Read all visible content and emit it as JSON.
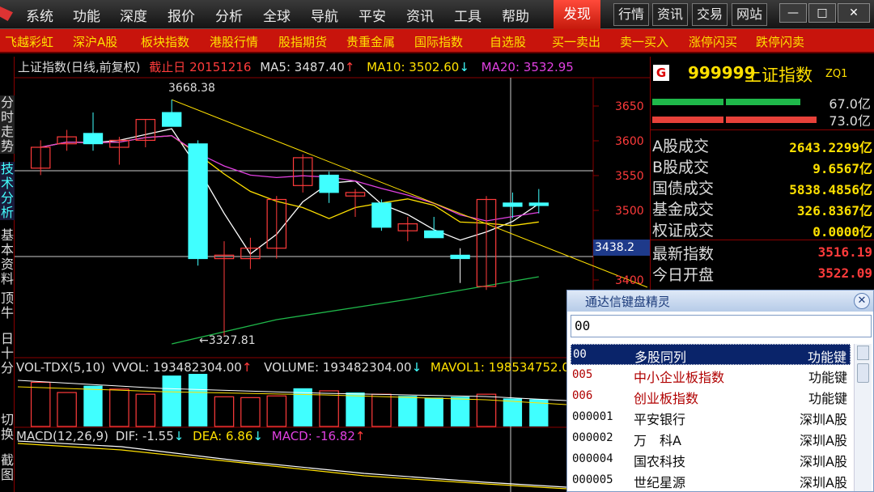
{
  "menubar": {
    "items": [
      "系统",
      "功能",
      "深度",
      "报价",
      "分析",
      "全球",
      "导航",
      "平安",
      "资讯",
      "工具",
      "帮助"
    ],
    "selected": "发现",
    "tabs": [
      "行情",
      "资讯",
      "交易",
      "网站"
    ],
    "window_controls": [
      "—",
      "□",
      "✕"
    ]
  },
  "quickbar": {
    "items": [
      "飞越彩虹",
      "深沪A股",
      "板块指数",
      "港股行情",
      "股指期货",
      "贵重金属",
      "国际指数",
      "自选股",
      "买一卖出",
      "卖一买入",
      "涨停闪买",
      "跌停闪卖"
    ]
  },
  "leftnav": {
    "items": [
      "分时走势",
      "技术分析",
      "基本资料",
      "顶牛",
      "日十分",
      "切换",
      "截图"
    ]
  },
  "chart_header": {
    "title": "上证指数(日线,前复权)",
    "cutoff": "截止日",
    "date": "20151216",
    "ma5": "MA5: 3487.40",
    "ma10": "MA10: 3502.60",
    "ma20": "MA20: 3532.95"
  },
  "chart_annotations": {
    "high": "3668.38",
    "low": "←3327.81",
    "price_marker": "3438.2"
  },
  "volume_header": {
    "name": "VOL-TDX(5,10)",
    "vvol": "VVOL: 193482304.00",
    "volume": "VOLUME: 193482304.00",
    "mavol1": "MAVOL1: 198534752.0"
  },
  "macd_header": {
    "name": "MACD(12,26,9)",
    "dif": "DIF: -1.55",
    "dea": "DEA: 6.86",
    "macd": "MACD: -16.82"
  },
  "chart_data": {
    "type": "candlestick",
    "y_ticks": [
      3650,
      3600,
      3550,
      3500,
      3450,
      3400
    ],
    "ylim": [
      3300,
      3700
    ],
    "candles": [
      {
        "o": 3570,
        "h": 3610,
        "l": 3560,
        "c": 3600,
        "dir": "up"
      },
      {
        "o": 3605,
        "h": 3625,
        "l": 3595,
        "c": 3615,
        "dir": "up"
      },
      {
        "o": 3620,
        "h": 3650,
        "l": 3595,
        "c": 3605,
        "dir": "down"
      },
      {
        "o": 3600,
        "h": 3615,
        "l": 3575,
        "c": 3610,
        "dir": "up"
      },
      {
        "o": 3610,
        "h": 3640,
        "l": 3600,
        "c": 3640,
        "dir": "up"
      },
      {
        "o": 3650,
        "h": 3668.38,
        "l": 3630,
        "c": 3630,
        "dir": "down"
      },
      {
        "o": 3605,
        "h": 3610,
        "l": 3430,
        "c": 3440,
        "dir": "down"
      },
      {
        "o": 3440,
        "h": 3465,
        "l": 3327.81,
        "c": 3445,
        "dir": "up"
      },
      {
        "o": 3440,
        "h": 3470,
        "l": 3425,
        "c": 3455,
        "dir": "up"
      },
      {
        "o": 3455,
        "h": 3530,
        "l": 3440,
        "c": 3525,
        "dir": "up"
      },
      {
        "o": 3545,
        "h": 3590,
        "l": 3535,
        "c": 3585,
        "dir": "up"
      },
      {
        "o": 3560,
        "h": 3565,
        "l": 3520,
        "c": 3535,
        "dir": "down"
      },
      {
        "o": 3530,
        "h": 3540,
        "l": 3500,
        "c": 3535,
        "dir": "up"
      },
      {
        "o": 3520,
        "h": 3525,
        "l": 3480,
        "c": 3485,
        "dir": "down"
      },
      {
        "o": 3480,
        "h": 3500,
        "l": 3465,
        "c": 3490,
        "dir": "up"
      },
      {
        "o": 3480,
        "h": 3500,
        "l": 3470,
        "c": 3470,
        "dir": "down"
      },
      {
        "o": 3445,
        "h": 3455,
        "l": 3405,
        "c": 3440,
        "dir": "flat"
      },
      {
        "o": 3400,
        "h": 3530,
        "l": 3395,
        "c": 3525,
        "dir": "up"
      },
      {
        "o": 3520,
        "h": 3535,
        "l": 3498,
        "c": 3515,
        "dir": "down"
      },
      {
        "o": 3520,
        "h": 3540,
        "l": 3505,
        "c": 3516.19,
        "dir": "down"
      }
    ],
    "volume": [
      52,
      40,
      48,
      44,
      38,
      60,
      62,
      35,
      34,
      36,
      45,
      42,
      40,
      38,
      36,
      34,
      35,
      38,
      33,
      32
    ],
    "volume_dir": [
      "up",
      "up",
      "down",
      "up",
      "up",
      "down",
      "down",
      "up",
      "up",
      "up",
      "down",
      "up",
      "down",
      "up",
      "down",
      "down",
      "down",
      "up",
      "down",
      "down"
    ]
  },
  "info_panel": {
    "badge": "G",
    "code": "999999",
    "name": "上证指数",
    "tag": "ZQ1",
    "bar1_value": "67.0亿",
    "bar2_value": "73.0亿",
    "rows": [
      {
        "label": "A股成交",
        "value": "2643.2299亿"
      },
      {
        "label": "B股成交",
        "value": "9.6567亿"
      },
      {
        "label": "国债成交",
        "value": "5838.4856亿"
      },
      {
        "label": "基金成交",
        "value": "326.8367亿"
      },
      {
        "label": "权证成交",
        "value": "0.0000亿"
      },
      {
        "label": "最新指数",
        "value": "3516.19"
      },
      {
        "label": "今日开盘",
        "value": "3522.09"
      }
    ]
  },
  "keyboard_elf": {
    "title": "通达信键盘精灵",
    "input_value": "00",
    "rows": [
      {
        "code": "00",
        "name": "多股同列",
        "type": "功能键"
      },
      {
        "code": "005",
        "name": "中小企业板指数",
        "type": "功能键"
      },
      {
        "code": "006",
        "name": "创业板指数",
        "type": "功能键"
      },
      {
        "code": "000001",
        "name": "平安银行",
        "type": "深圳A股"
      },
      {
        "code": "000002",
        "name": "万　科A",
        "type": "深圳A股"
      },
      {
        "code": "000004",
        "name": "国农科技",
        "type": "深圳A股"
      },
      {
        "code": "000005",
        "name": "世纪星源",
        "type": "深圳A股"
      }
    ]
  },
  "colors": {
    "up": "#ff3b3b",
    "down": "#40ffff",
    "accent": "#c8140c",
    "yellow": "#ffe000"
  }
}
